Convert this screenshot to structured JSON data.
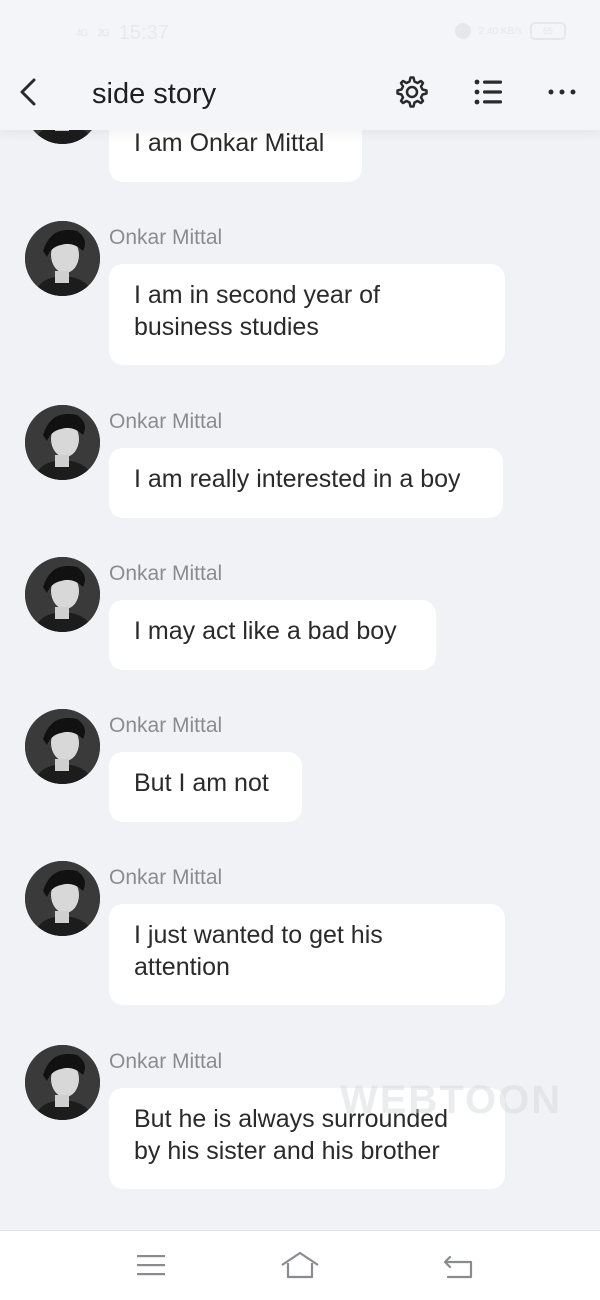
{
  "status": {
    "signal_left": "4G",
    "signal_right": "2G",
    "time": "15:37",
    "speed": "2.40 KB/s",
    "battery": "65"
  },
  "header": {
    "title": "side story",
    "icons": [
      "back-arrow-icon",
      "gear-icon",
      "list-icon",
      "more-dots-icon"
    ]
  },
  "messages": [
    {
      "sender": "",
      "text": "I am Onkar Mittal"
    },
    {
      "sender": "Onkar Mittal",
      "text": "I am in second year of\nbusiness studies"
    },
    {
      "sender": "Onkar Mittal",
      "text": "I am really interested in a boy"
    },
    {
      "sender": "Onkar Mittal",
      "text": "I may act like a bad boy"
    },
    {
      "sender": "Onkar Mittal",
      "text": "But I am not"
    },
    {
      "sender": "Onkar Mittal",
      "text": "I just wanted to get his\nattention"
    },
    {
      "sender": "Onkar Mittal",
      "text": "But he is always surrounded\nby his sister and his brother"
    }
  ],
  "watermark": "WEBTOON",
  "navbar": {
    "icons": [
      "menu-icon",
      "home-icon",
      "back-icon"
    ]
  },
  "colors": {
    "background": "#f1f2f6",
    "bubble": "#ffffff",
    "sender_text": "#8b8c90",
    "message_text": "#2a2a2a"
  }
}
